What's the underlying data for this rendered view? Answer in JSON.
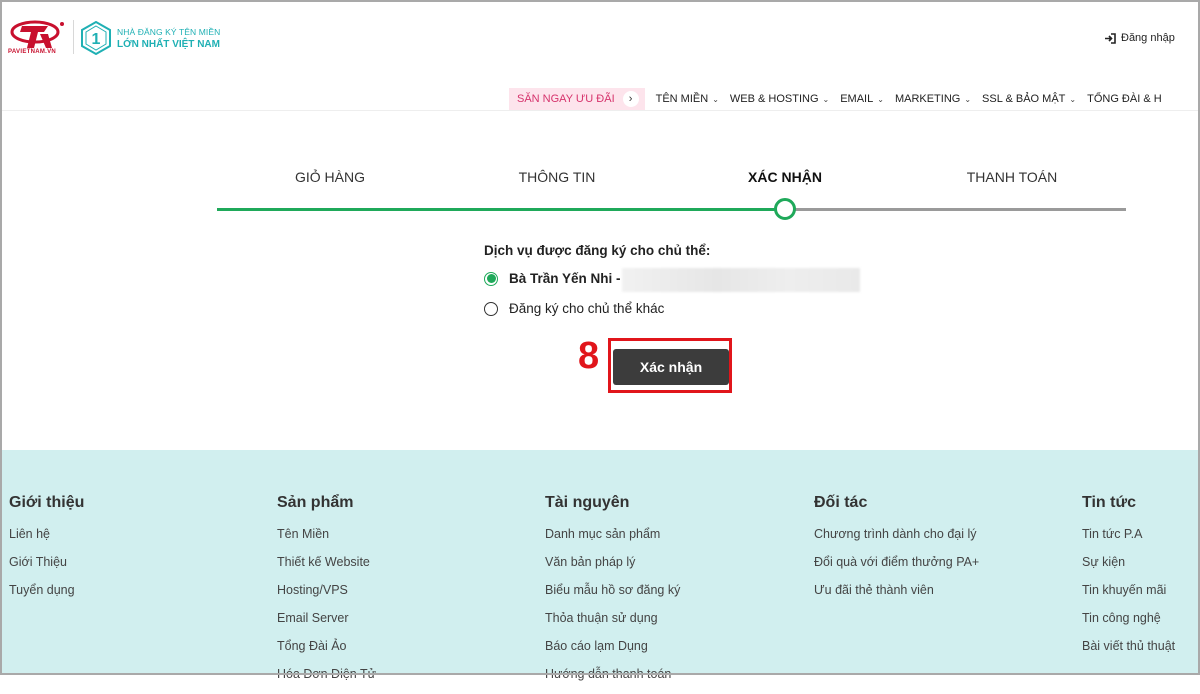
{
  "brand": {
    "logo_text": "PAVIETNAM.VN",
    "tagline_line1": "NHÀ ĐĂNG KÝ TÊN MIỀN",
    "tagline_line2": "LỚN NHẤT VIỆT NAM",
    "badge_number": "1",
    "primary_color": "#c8102e",
    "teal_color": "#1fb0b4"
  },
  "header": {
    "login_label": "Đăng nhập",
    "login_icon": "sign-in-icon"
  },
  "nav": {
    "promo_label": "SĂN NGAY ƯU ĐÃI",
    "items": [
      {
        "label": "TÊN MIỀN"
      },
      {
        "label": "WEB & HOSTING"
      },
      {
        "label": "EMAIL"
      },
      {
        "label": "MARKETING"
      },
      {
        "label": "SSL & BẢO MẬT"
      },
      {
        "label": "TỔNG ĐÀI & H"
      }
    ]
  },
  "steps": {
    "items": [
      {
        "label": "GIỎ HÀNG"
      },
      {
        "label": "THÔNG TIN"
      },
      {
        "label": "XÁC NHẬN"
      },
      {
        "label": "THANH TOÁN"
      }
    ],
    "active_step": 3,
    "progress_color": "#1fa95a"
  },
  "form": {
    "title": "Dịch vụ được đăng ký cho chủ thể:",
    "options": [
      {
        "label": "Bà Trần Yến Nhi -",
        "checked": true
      },
      {
        "label": "Đăng ký cho chủ thể khác",
        "checked": false
      }
    ],
    "confirm_label": "Xác nhận",
    "annotation_number": "8",
    "annotation_color": "#e1151b"
  },
  "footer": {
    "background": "#d1efef",
    "columns": [
      {
        "title": "Giới thiệu",
        "links": [
          "Liên hệ",
          "Giới Thiệu",
          "Tuyển dụng"
        ]
      },
      {
        "title": "Sản phẩm",
        "links": [
          "Tên Miền",
          "Thiết kế Website",
          "Hosting/VPS",
          "Email Server",
          "Tổng Đài Ảo",
          "Hóa Đơn Điện Tử"
        ]
      },
      {
        "title": "Tài nguyên",
        "links": [
          "Danh mục sản phẩm",
          "Văn bản pháp lý",
          "Biểu mẫu hồ sơ đăng ký",
          "Thỏa thuận sử dụng",
          "Báo cáo lạm Dụng",
          "Hướng dẫn thanh toán"
        ]
      },
      {
        "title": "Đối tác",
        "links": [
          "Chương trình dành cho đại lý",
          "Đổi quà với điểm thưởng PA+",
          "Ưu đãi thẻ thành viên"
        ]
      },
      {
        "title": "Tin tức",
        "links": [
          "Tin tức P.A",
          "Sự kiện",
          "Tin khuyến mãi",
          "Tin công nghệ",
          "Bài viết thủ thuật"
        ]
      }
    ]
  }
}
